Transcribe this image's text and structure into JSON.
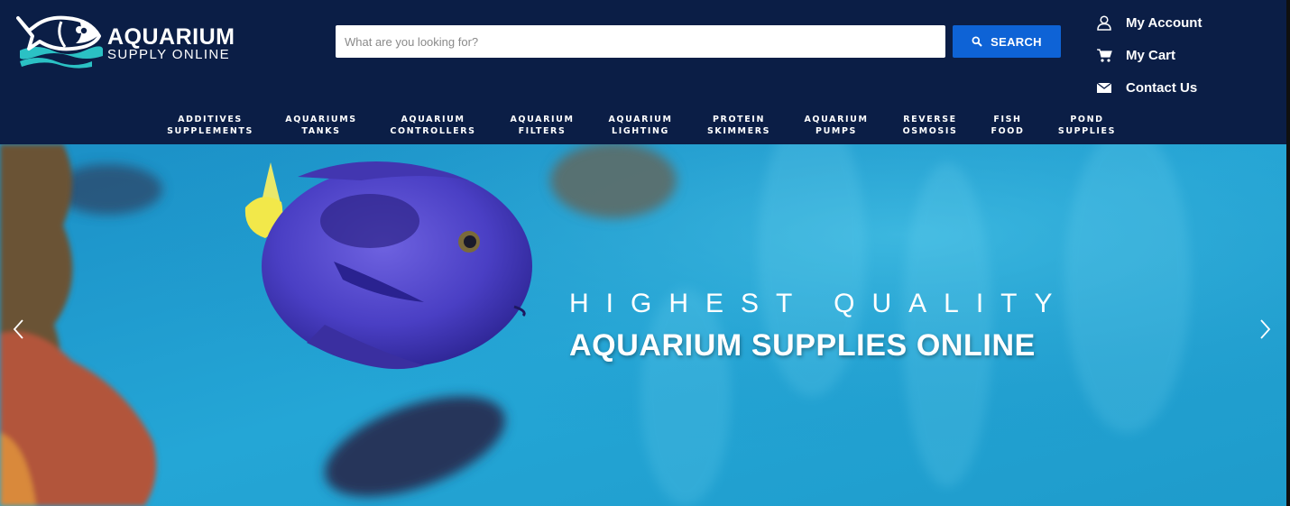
{
  "logo": {
    "word": "AQUARIUM",
    "sub": "SUPPLY ONLINE"
  },
  "search": {
    "placeholder": "What are you looking for?",
    "value": "",
    "button_label": "SEARCH",
    "icon": "search-icon"
  },
  "account_links": [
    {
      "label": "My Account",
      "icon": "user-icon"
    },
    {
      "label": "My Cart",
      "icon": "cart-icon"
    },
    {
      "label": "Contact Us",
      "icon": "mail-icon"
    }
  ],
  "nav": [
    {
      "line1": "ADDITIVES",
      "line2": "SUPPLEMENTS"
    },
    {
      "line1": "AQUARIUMS",
      "line2": "TANKS"
    },
    {
      "line1": "AQUARIUM",
      "line2": "CONTROLLERS"
    },
    {
      "line1": "AQUARIUM",
      "line2": "FILTERS"
    },
    {
      "line1": "AQUARIUM",
      "line2": "LIGHTING"
    },
    {
      "line1": "PROTEIN",
      "line2": "SKIMMERS"
    },
    {
      "line1": "AQUARIUM",
      "line2": "PUMPS"
    },
    {
      "line1": "REVERSE",
      "line2": "OSMOSIS"
    },
    {
      "line1": "FISH",
      "line2": "FOOD"
    },
    {
      "line1": "POND",
      "line2": "SUPPLIES"
    }
  ],
  "hero": {
    "eyebrow": "HIGHEST QUALITY",
    "title": "AQUARIUM SUPPLIES ONLINE",
    "prev_icon": "chevron-left-icon",
    "next_icon": "chevron-right-icon"
  },
  "colors": {
    "header_bg": "#0b1e46",
    "search_button": "#0e63d6",
    "logo_teal": "#2bc1c4",
    "water": "#1f9ecf"
  }
}
